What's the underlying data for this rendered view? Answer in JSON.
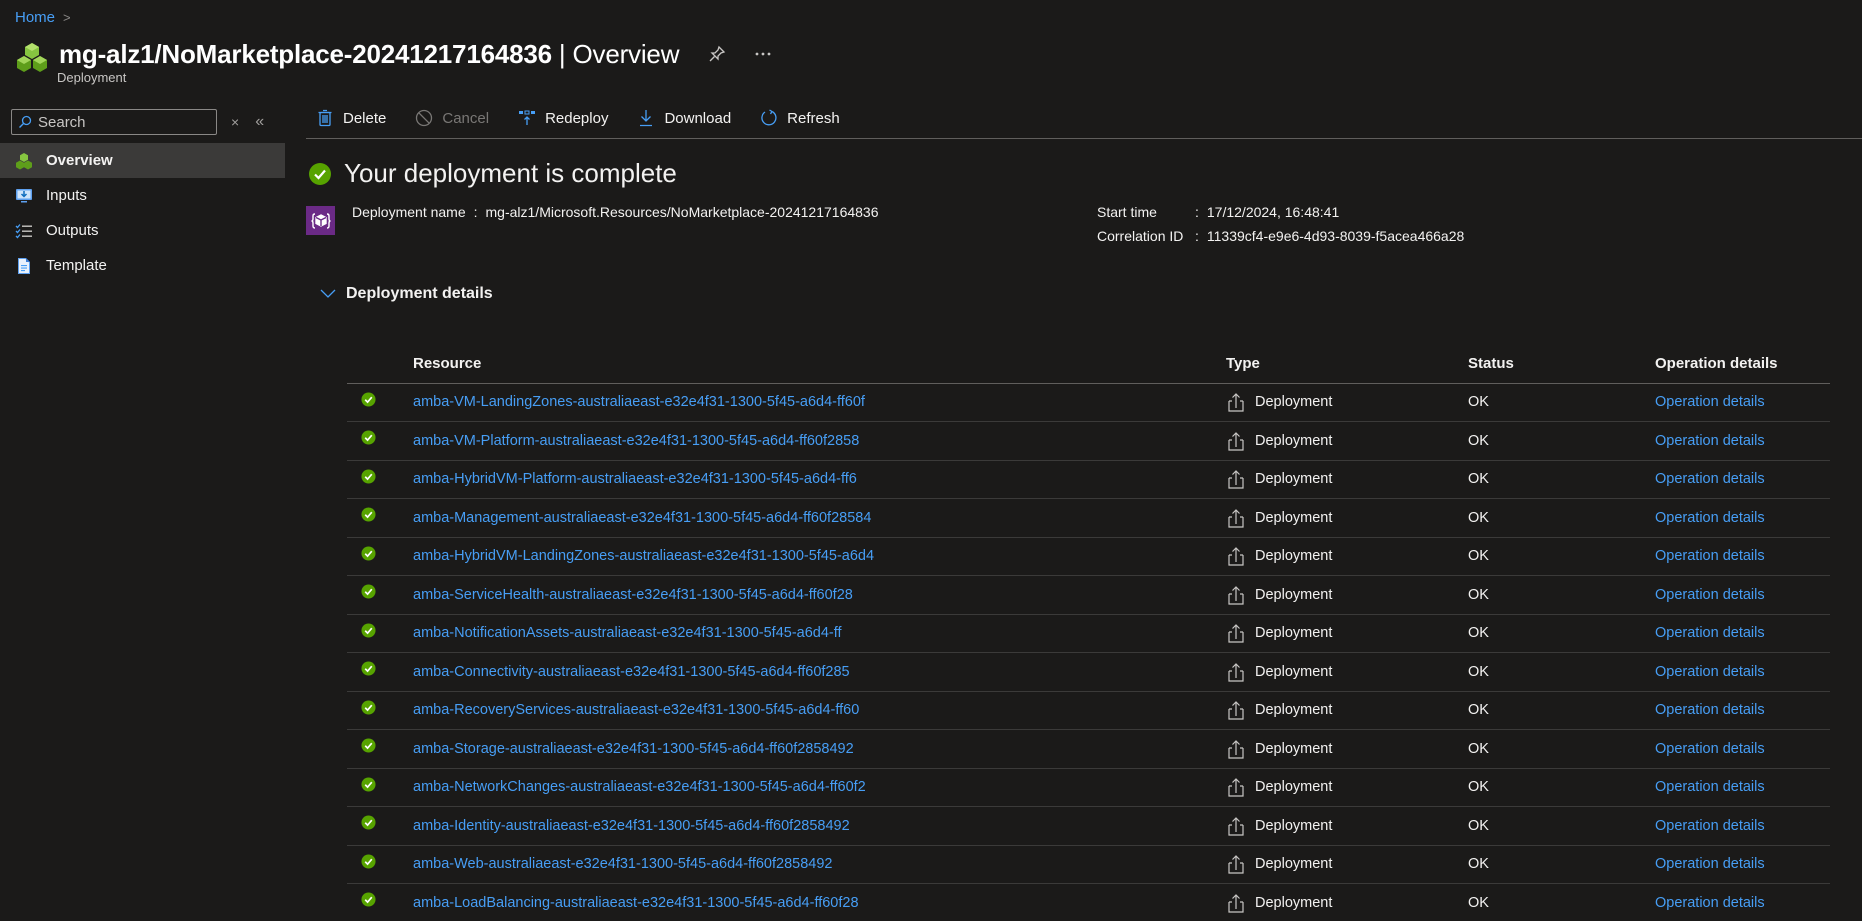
{
  "breadcrumb": {
    "home": "Home",
    "separator": ">"
  },
  "header": {
    "title_main": "mg-alz1/NoMarketplace-20241217164836",
    "title_sep": "|",
    "title_section": "Overview",
    "subtitle": "Deployment",
    "pin_icon": "pin-icon",
    "more_icon": "ellipsis-icon"
  },
  "sidebar": {
    "search_placeholder": "Search",
    "clear_label": "×",
    "collapse_label": "«",
    "items": [
      {
        "label": "Overview",
        "icon": "cubes-icon",
        "active": true
      },
      {
        "label": "Inputs",
        "icon": "inputs-icon",
        "active": false
      },
      {
        "label": "Outputs",
        "icon": "outputs-icon",
        "active": false
      },
      {
        "label": "Template",
        "icon": "template-icon",
        "active": false
      }
    ]
  },
  "toolbar": {
    "delete": "Delete",
    "cancel": "Cancel",
    "redeploy": "Redeploy",
    "download": "Download",
    "refresh": "Refresh"
  },
  "status": {
    "heading": "Your deployment is complete",
    "deployment_name_label": "Deployment name",
    "deployment_name": "mg-alz1/Microsoft.Resources/NoMarketplace-20241217164836",
    "start_time_label": "Start time",
    "start_time": "17/12/2024, 16:48:41",
    "correlation_label": "Correlation ID",
    "correlation_id": "11339cf4-e9e6-4d93-8039-f5acea466a28"
  },
  "details": {
    "title": "Deployment details",
    "columns": {
      "resource": "Resource",
      "type": "Type",
      "status": "Status",
      "operation": "Operation details"
    },
    "rows": [
      {
        "resource": "amba-VM-LandingZones-australiaeast-e32e4f31-1300-5f45-a6d4-ff60f",
        "type": "Deployment",
        "status": "OK",
        "operation": "Operation details"
      },
      {
        "resource": "amba-VM-Platform-australiaeast-e32e4f31-1300-5f45-a6d4-ff60f2858",
        "type": "Deployment",
        "status": "OK",
        "operation": "Operation details"
      },
      {
        "resource": "amba-HybridVM-Platform-australiaeast-e32e4f31-1300-5f45-a6d4-ff6",
        "type": "Deployment",
        "status": "OK",
        "operation": "Operation details"
      },
      {
        "resource": "amba-Management-australiaeast-e32e4f31-1300-5f45-a6d4-ff60f28584",
        "type": "Deployment",
        "status": "OK",
        "operation": "Operation details"
      },
      {
        "resource": "amba-HybridVM-LandingZones-australiaeast-e32e4f31-1300-5f45-a6d4",
        "type": "Deployment",
        "status": "OK",
        "operation": "Operation details"
      },
      {
        "resource": "amba-ServiceHealth-australiaeast-e32e4f31-1300-5f45-a6d4-ff60f28",
        "type": "Deployment",
        "status": "OK",
        "operation": "Operation details"
      },
      {
        "resource": "amba-NotificationAssets-australiaeast-e32e4f31-1300-5f45-a6d4-ff",
        "type": "Deployment",
        "status": "OK",
        "operation": "Operation details"
      },
      {
        "resource": "amba-Connectivity-australiaeast-e32e4f31-1300-5f45-a6d4-ff60f285",
        "type": "Deployment",
        "status": "OK",
        "operation": "Operation details"
      },
      {
        "resource": "amba-RecoveryServices-australiaeast-e32e4f31-1300-5f45-a6d4-ff60",
        "type": "Deployment",
        "status": "OK",
        "operation": "Operation details"
      },
      {
        "resource": "amba-Storage-australiaeast-e32e4f31-1300-5f45-a6d4-ff60f2858492",
        "type": "Deployment",
        "status": "OK",
        "operation": "Operation details"
      },
      {
        "resource": "amba-NetworkChanges-australiaeast-e32e4f31-1300-5f45-a6d4-ff60f2",
        "type": "Deployment",
        "status": "OK",
        "operation": "Operation details"
      },
      {
        "resource": "amba-Identity-australiaeast-e32e4f31-1300-5f45-a6d4-ff60f2858492",
        "type": "Deployment",
        "status": "OK",
        "operation": "Operation details"
      },
      {
        "resource": "amba-Web-australiaeast-e32e4f31-1300-5f45-a6d4-ff60f2858492",
        "type": "Deployment",
        "status": "OK",
        "operation": "Operation details"
      },
      {
        "resource": "amba-LoadBalancing-australiaeast-e32e4f31-1300-5f45-a6d4-ff60f28",
        "type": "Deployment",
        "status": "OK",
        "operation": "Operation details"
      }
    ]
  },
  "colors": {
    "background": "#1b1a19",
    "link": "#479ef5",
    "success": "#57a300",
    "selected_nav": "#3b3a39",
    "deployment_badge": "#6b2a86"
  }
}
